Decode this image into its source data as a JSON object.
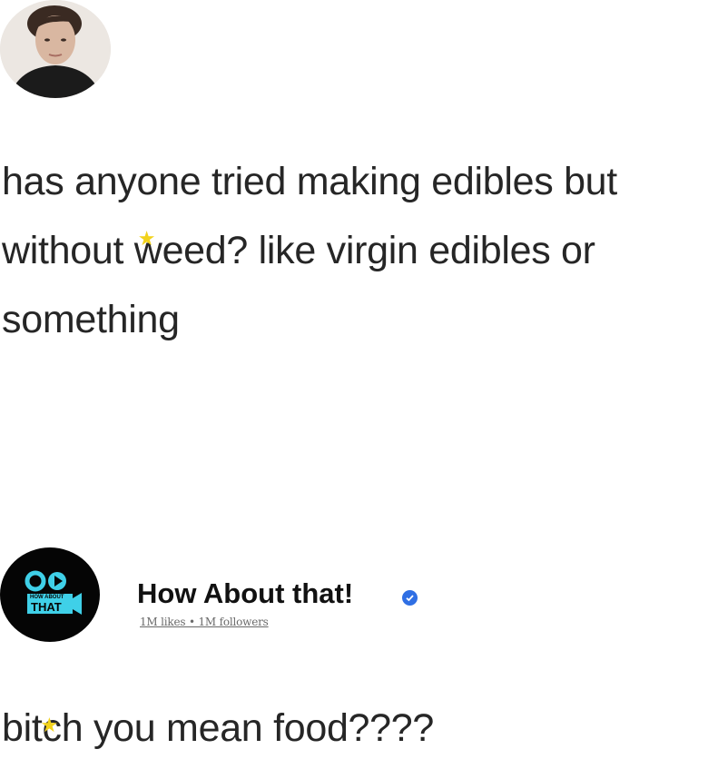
{
  "post": {
    "lines": [
      {
        "text": "has anyone tried making edibles but"
      },
      {
        "before": "without ",
        "after": "eed? like virgin edibles or"
      },
      {
        "text": "something"
      }
    ]
  },
  "page": {
    "name": "How About that!",
    "stats": "1M likes • 1M followers",
    "logo_lines": [
      "HOW ABOUT",
      "THAT"
    ],
    "verified_icon": "verified-check-icon",
    "verified_color": "#2f6fe4",
    "logo_accent": "#3fd0e8"
  },
  "reply": {
    "before": "bit",
    "after": "h you mean food????"
  },
  "colors": {
    "star": "#f2d21b",
    "text": "#262626"
  }
}
